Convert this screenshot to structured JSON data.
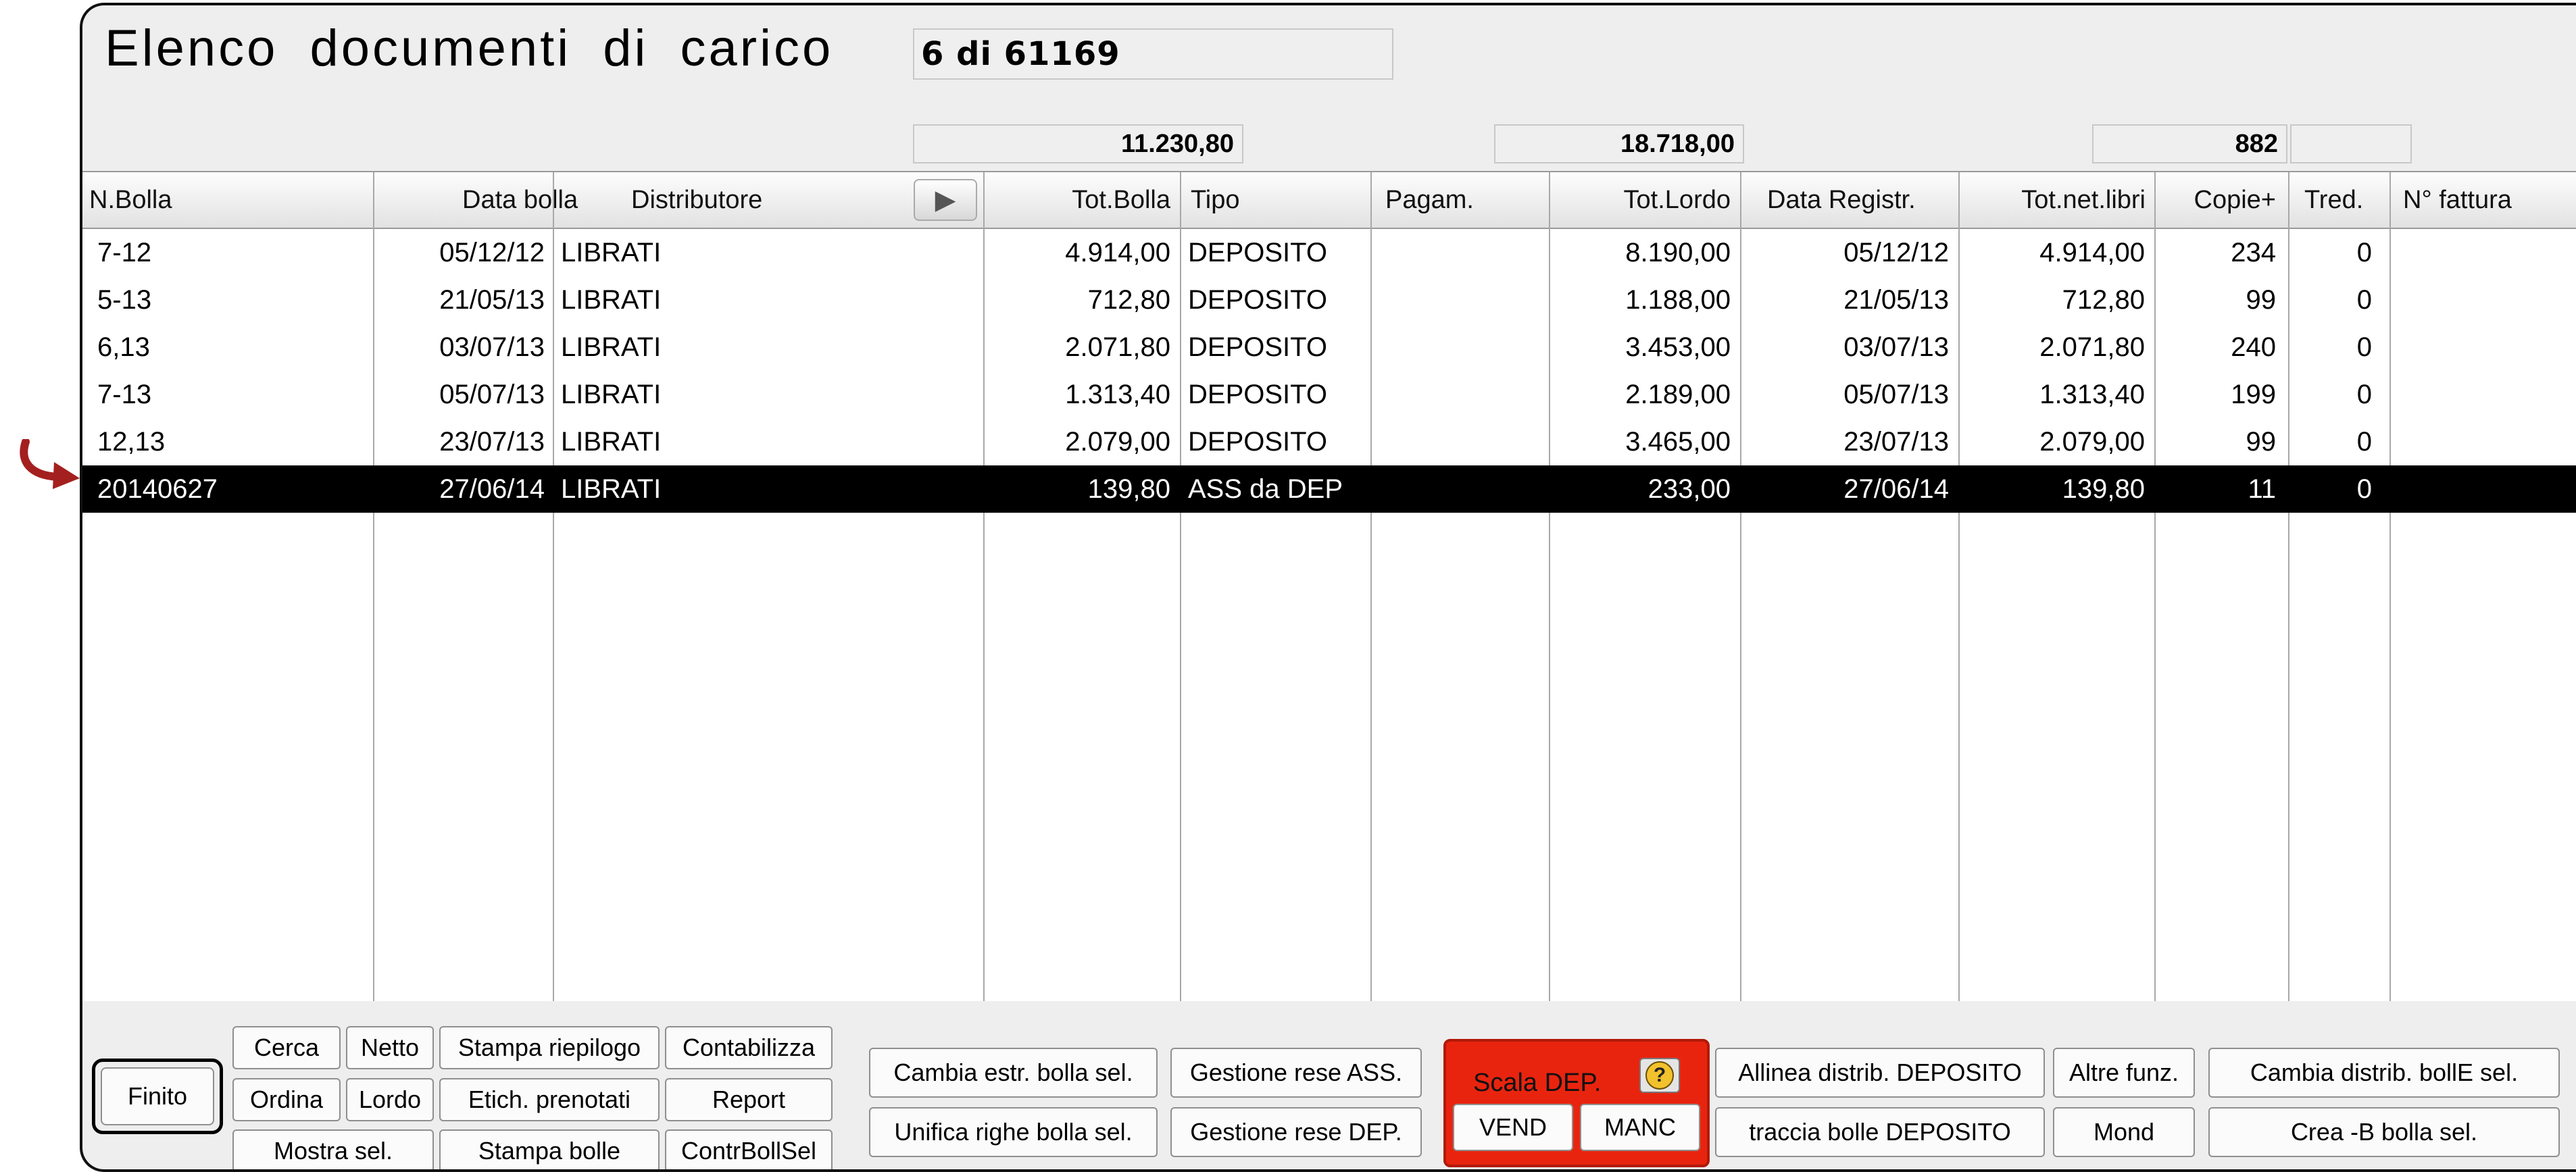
{
  "window": {
    "title": "Elenco documenti di carico",
    "record_count": "6 di 61169"
  },
  "totals": {
    "tot_bolla": "11.230,80",
    "tot_lordo": "18.718,00",
    "copie": "882",
    "tred": ""
  },
  "table": {
    "columns": [
      "N.Bolla",
      "Data bolla",
      "Distributore",
      "Tot.Bolla",
      "Tipo",
      "Pagam.",
      "Tot.Lordo",
      "Data Registr.",
      "Tot.net.libri",
      "Copie+",
      "Tred.",
      "N° fattura"
    ],
    "rows": [
      [
        "7-12",
        "05/12/12",
        "LIBRATI",
        "4.914,00",
        "DEPOSITO",
        "",
        "8.190,00",
        "05/12/12",
        "4.914,00",
        "234",
        "0",
        ""
      ],
      [
        "5-13",
        "21/05/13",
        "LIBRATI",
        "712,80",
        "DEPOSITO",
        "",
        "1.188,00",
        "21/05/13",
        "712,80",
        "99",
        "0",
        ""
      ],
      [
        "6,13",
        "03/07/13",
        "LIBRATI",
        "2.071,80",
        "DEPOSITO",
        "",
        "3.453,00",
        "03/07/13",
        "2.071,80",
        "240",
        "0",
        ""
      ],
      [
        "7-13",
        "05/07/13",
        "LIBRATI",
        "1.313,40",
        "DEPOSITO",
        "",
        "2.189,00",
        "05/07/13",
        "1.313,40",
        "199",
        "0",
        ""
      ],
      [
        "12,13",
        "23/07/13",
        "LIBRATI",
        "2.079,00",
        "DEPOSITO",
        "",
        "3.465,00",
        "23/07/13",
        "2.079,00",
        "99",
        "0",
        ""
      ],
      [
        "20140627",
        "27/06/14",
        "LIBRATI",
        "139,80",
        "ASS da DEP",
        "",
        "233,00",
        "27/06/14",
        "139,80",
        "11",
        "0",
        ""
      ]
    ],
    "selected_row": 5
  },
  "buttons": {
    "finito": "Finito",
    "cerca": "Cerca",
    "netto": "Netto",
    "stampa_riepilogo": "Stampa riepilogo",
    "contabilizza": "Contabilizza",
    "ordina": "Ordina",
    "lordo": "Lordo",
    "etich_prenotati": "Etich. prenotati",
    "report": "Report",
    "mostra_sel": "Mostra sel.",
    "stampa_bolle": "Stampa bolle",
    "contr_boll_sel": "ContrBollSel",
    "cambia_estr": "Cambia estr. bolla sel.",
    "unifica_righe": "Unifica righe bolla sel.",
    "gestione_rese_ass": "Gestione rese ASS.",
    "gestione_rese_dep": "Gestione rese DEP.",
    "scala_dep": "Scala DEP.",
    "vend": "VEND",
    "manc": "MANC",
    "allinea_distrib": "Allinea distrib. DEPOSITO",
    "traccia_bolle": "traccia bolle DEPOSITO",
    "altre_funz": "Altre funz.",
    "mond": "Mond",
    "cambia_distrib": "Cambia distrib. bollE sel.",
    "crea_b": "Crea -B bolla sel."
  },
  "colors": {
    "selected_row": "#000000",
    "scala_panel": "#e8240f",
    "arrow": "#a3201f"
  }
}
